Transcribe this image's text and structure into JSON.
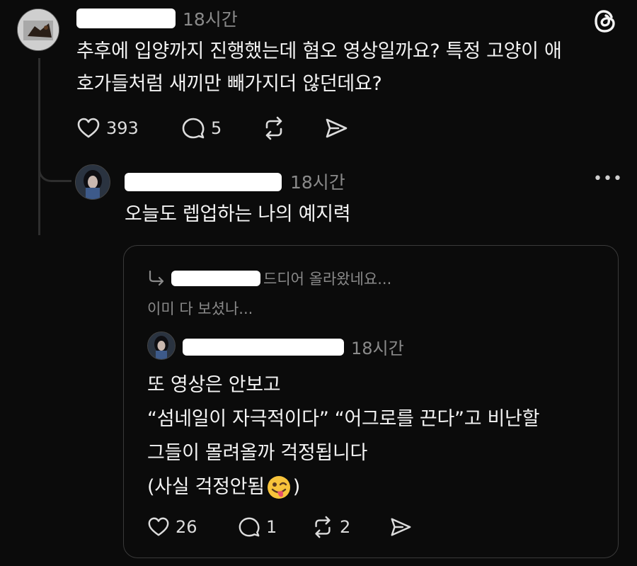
{
  "post": {
    "time": "18시간",
    "text_lines": [
      "추후에 입양까지 진행했는데 혐오 영상일까요? 특정 고양이 애",
      "호가들처럼 새끼만 빼가지더 않던데요?"
    ],
    "likes": "393",
    "comments": "5"
  },
  "reply": {
    "time": "18시간",
    "text": "오늘도 렙업하는 나의 예지력",
    "more_label": "•••"
  },
  "quote": {
    "reply_to_text": "드디어 올라왔네요...",
    "preview_text": "이미 다 보셨나...",
    "time": "18시간",
    "text_lines": [
      "또 영상은 안보고",
      "“섬네일이 자극적이다” “어그로를 끈다”고 비난할",
      "그들이 몰려올까 걱정됩니다",
      "(사실 걱정안됨",
      ")"
    ],
    "likes": "26",
    "comments": "1",
    "reposts": "2"
  },
  "icons": {
    "app": "threads-logo-icon",
    "like": "heart-icon",
    "comment": "comment-bubble-icon",
    "repost": "repost-icon",
    "share": "send-icon",
    "reply_arrow": "reply-arrow-icon",
    "emoji": "winking-tongue-emoji"
  },
  "colors": {
    "background": "#0b0b0b",
    "text": "#f3f3f3",
    "muted": "#8a8a8a",
    "border": "#3a3a3a"
  }
}
